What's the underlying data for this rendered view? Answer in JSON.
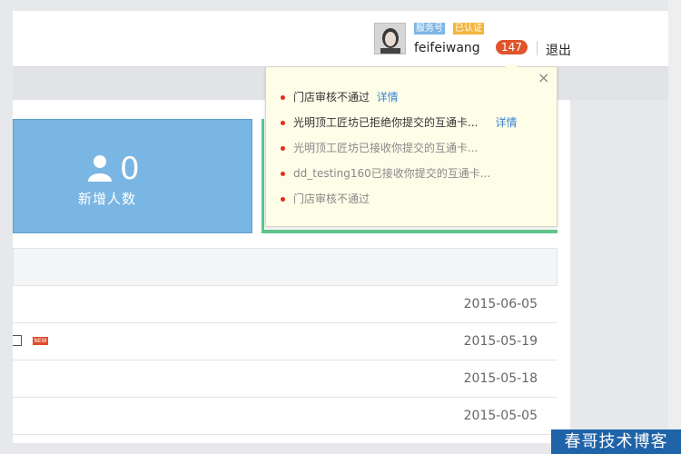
{
  "header": {
    "tag_service": "服务号",
    "tag_verified": "已认证",
    "username": "feifeiwang",
    "notification_count": "147",
    "logout_label": "退出"
  },
  "stats": {
    "new_users_value": "0",
    "new_users_label": "新增人数"
  },
  "popup": {
    "close_glyph": "×",
    "items": [
      {
        "text": "门店审核不通过",
        "link": "详情",
        "tone": "dark"
      },
      {
        "text": "光明顶工匠坊已拒绝你提交的互通卡...",
        "link": "详情",
        "tone": "dark"
      },
      {
        "text": "光明顶工匠坊已接收你提交的互通卡...",
        "link": "",
        "tone": "gray"
      },
      {
        "text": "dd_testing160已接收你提交的互通卡...",
        "link": "",
        "tone": "gray"
      },
      {
        "text": "门店审核不通过",
        "link": "",
        "tone": "gray"
      }
    ]
  },
  "table": {
    "rows": [
      {
        "date": "2015-06-05"
      },
      {
        "date": "2015-05-19",
        "new_tag": "NEW"
      },
      {
        "date": "2015-05-18"
      },
      {
        "date": "2015-05-05"
      }
    ]
  },
  "watermark": "春哥技术博客",
  "colors": {
    "stat_blue": "#7ab6e3",
    "green_accent": "#5ec48c",
    "badge_red": "#e0552c",
    "link_blue": "#3b86d4"
  }
}
